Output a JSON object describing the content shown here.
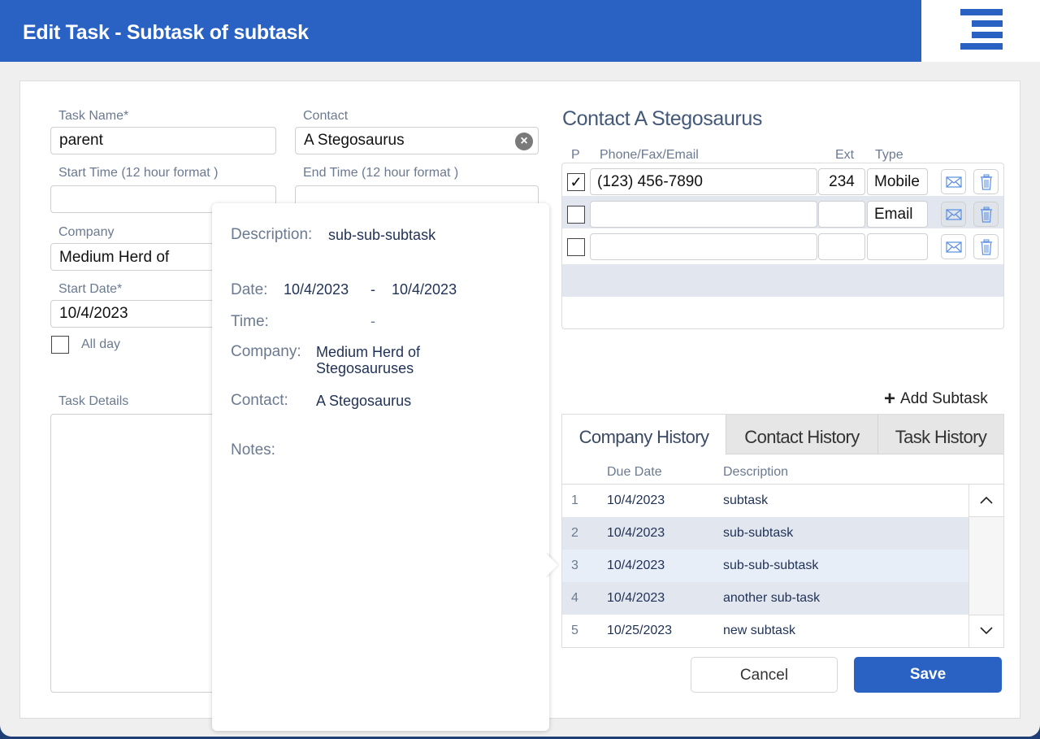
{
  "header": {
    "title": "Edit Task  - Subtask of subtask",
    "menu_icon": "hamburger-menu-icon",
    "brand_color": "#2a62c4"
  },
  "form": {
    "task_name": {
      "label": "Task Name*",
      "value": "parent"
    },
    "contact": {
      "label": "Contact",
      "value": "A Stegosaurus",
      "clear_icon": "×"
    },
    "start_time": {
      "label": "Start Time (12 hour format )",
      "value": ""
    },
    "end_time": {
      "label": "End Time (12 hour format )",
      "value": ""
    },
    "company": {
      "label": "Company",
      "value": "Medium Herd of Stegosauruses"
    },
    "start_date": {
      "label": "Start Date*",
      "value": "10/4/2023"
    },
    "all_day": {
      "label": "All day",
      "checked": false
    },
    "task_details": {
      "label": "Task Details",
      "value": ""
    }
  },
  "popover": {
    "description_label": "Description:",
    "description_value": "sub-sub-subtask",
    "date_label": "Date:",
    "date_start": "10/4/2023",
    "date_sep": "-",
    "date_end": "10/4/2023",
    "time_label": "Time:",
    "time_sep": "-",
    "company_label": "Company:",
    "company_value_line1": "Medium Herd of",
    "company_value_line2": "Stegosauruses",
    "contact_label": "Contact:",
    "contact_value": "A Stegosaurus",
    "notes_label": "Notes:"
  },
  "contact_panel": {
    "title": "Contact A Stegosaurus",
    "headers": {
      "p": "P",
      "phone": "Phone/Fax/Email",
      "ext": "Ext",
      "type": "Type"
    },
    "rows": [
      {
        "primary": true,
        "primary_mark": "✓",
        "phone": "(123) 456-7890",
        "ext": "234",
        "type": "Mobile"
      },
      {
        "primary": false,
        "primary_mark": "",
        "phone": "",
        "ext": "",
        "type": "Email"
      },
      {
        "primary": false,
        "primary_mark": "",
        "phone": "",
        "ext": "",
        "type": ""
      }
    ]
  },
  "add_subtask": {
    "icon": "+",
    "label": "Add Subtask"
  },
  "history": {
    "tabs": [
      {
        "label": "Company History",
        "active": true
      },
      {
        "label": "Contact History",
        "active": false
      },
      {
        "label": "Task History",
        "active": false
      }
    ],
    "headers": {
      "due_date": "Due Date",
      "description": "Description"
    },
    "rows": [
      {
        "num": "1",
        "due_date": "10/4/2023",
        "description": "subtask"
      },
      {
        "num": "2",
        "due_date": "10/4/2023",
        "description": "sub-subtask"
      },
      {
        "num": "3",
        "due_date": "10/4/2023",
        "description": "sub-sub-subtask"
      },
      {
        "num": "4",
        "due_date": "10/4/2023",
        "description": "another sub-task"
      },
      {
        "num": "5",
        "due_date": "10/25/2023",
        "description": "new subtask"
      }
    ],
    "scroll_up": "︿",
    "scroll_down": "﹀"
  },
  "actions": {
    "cancel": "Cancel",
    "save": "Save"
  }
}
